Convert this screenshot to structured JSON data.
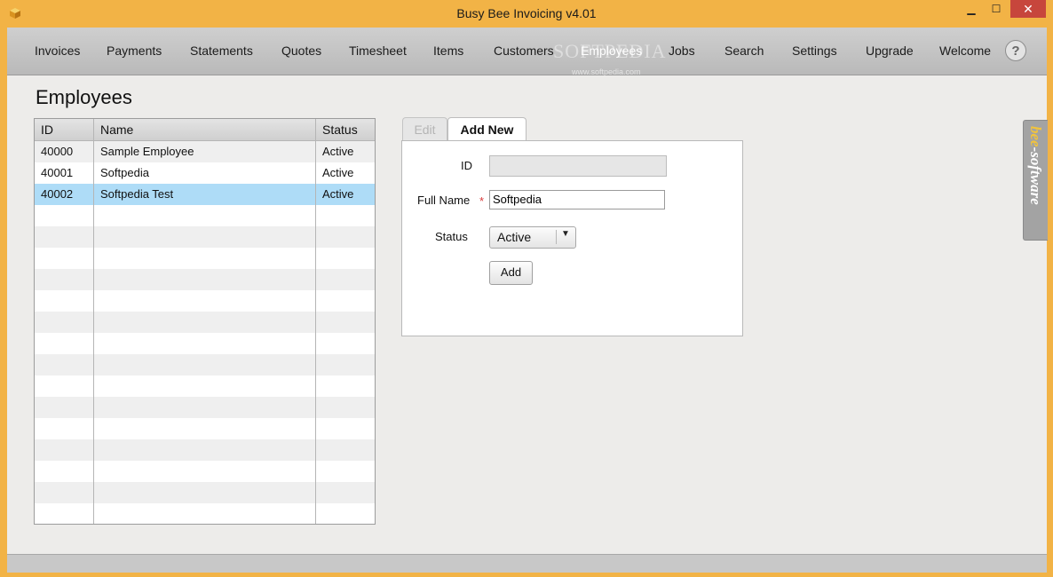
{
  "window": {
    "title": "Busy Bee Invoicing v4.01"
  },
  "nav": {
    "items": [
      "Invoices",
      "Payments",
      "Statements",
      "Quotes",
      "Timesheet",
      "Items",
      "Customers",
      "Employees",
      "Jobs",
      "Search",
      "Settings",
      "Upgrade",
      "Welcome"
    ],
    "active": "Employees",
    "help_label": "?"
  },
  "watermark": {
    "main": "SOFTPEDIA",
    "small": "www.softpedia.com"
  },
  "page": {
    "title": "Employees"
  },
  "grid": {
    "columns": [
      "ID",
      "Name",
      "Status"
    ],
    "rows": [
      {
        "id": "40000",
        "name": "Sample Employee",
        "status": "Active"
      },
      {
        "id": "40001",
        "name": "Softpedia",
        "status": "Active"
      },
      {
        "id": "40002",
        "name": "Softpedia Test",
        "status": "Active"
      }
    ],
    "selected_row": 2
  },
  "form": {
    "tabs": [
      "Edit",
      "Add New"
    ],
    "active_tab": "Add New",
    "id_label": "ID",
    "id_value": "",
    "name_label": "Full Name",
    "required_mark": "*",
    "name_value": "Softpedia",
    "status_label": "Status",
    "status_value": "Active",
    "add_label": "Add"
  },
  "brand": {
    "vertical_text_hl": "bee",
    "vertical_text_rest": "-software"
  },
  "colors": {
    "title_bar": "#f2b346",
    "selected_row": "#aedcf7",
    "close_button": "#c7463c"
  }
}
